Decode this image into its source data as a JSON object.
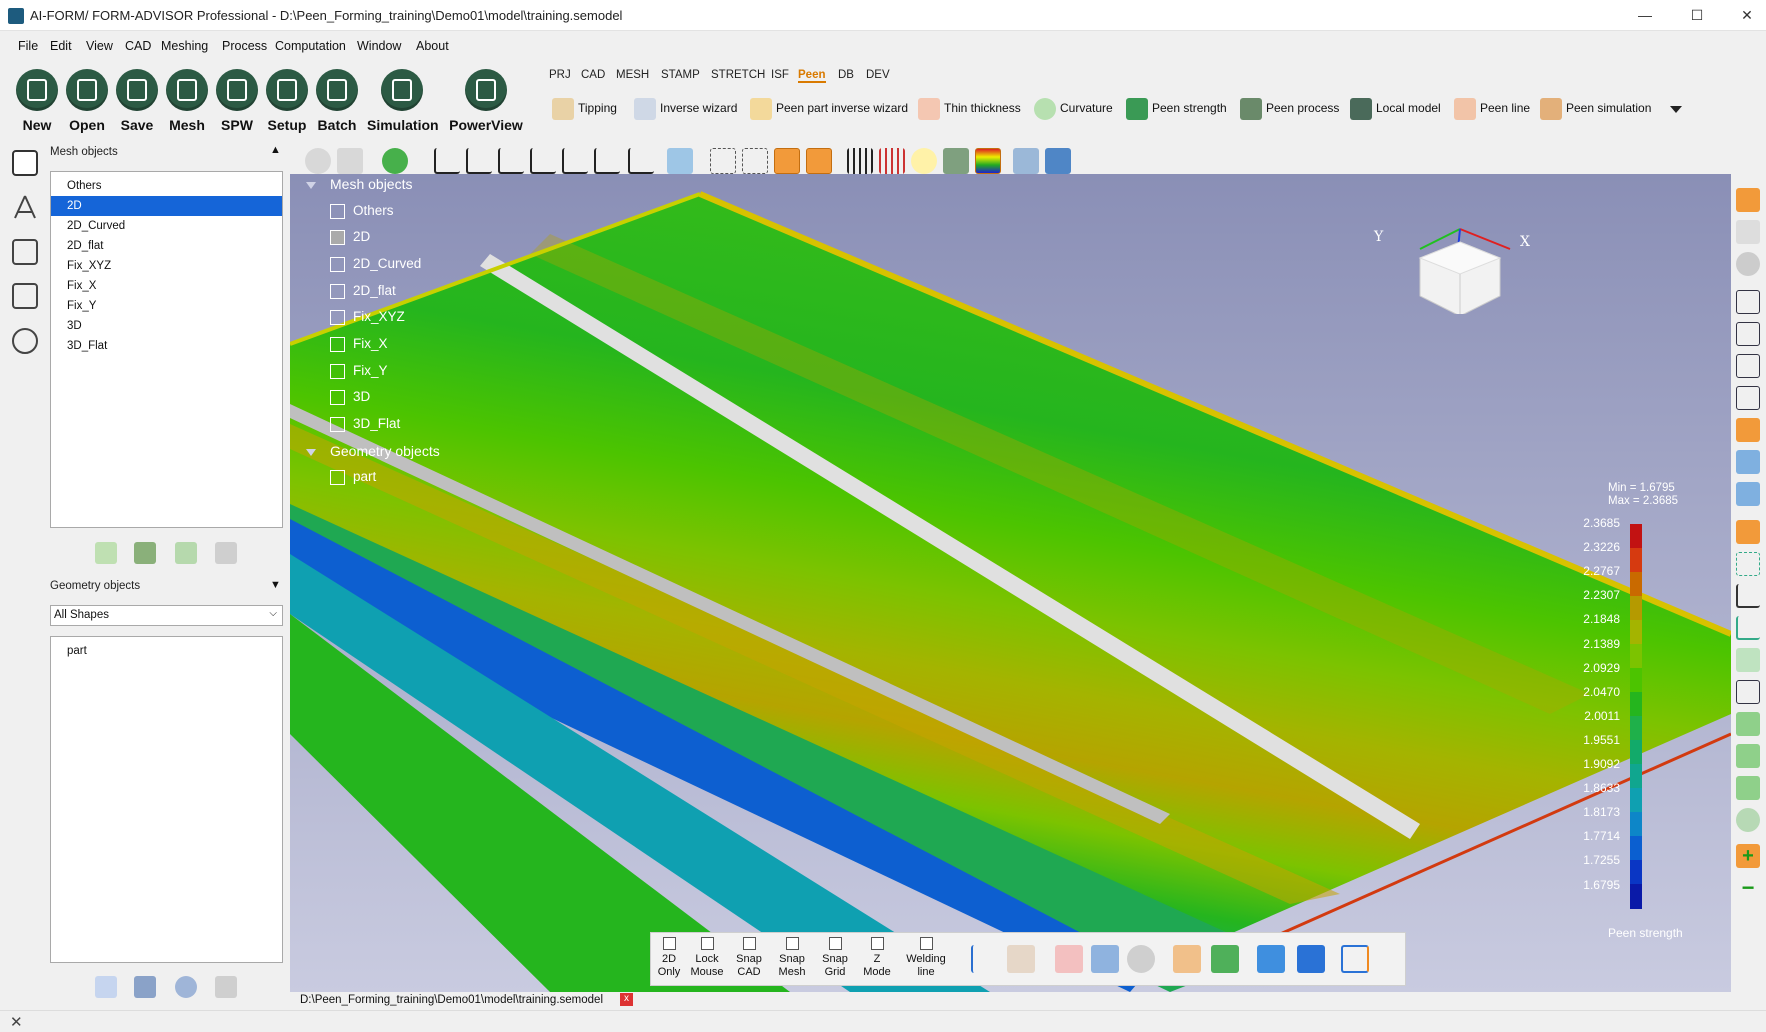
{
  "window": {
    "title": "AI-FORM/ FORM-ADVISOR Professional - D:\\Peen_Forming_training\\Demo01\\model\\training.semodel",
    "minimize": "—",
    "maximize": "☐",
    "close": "✕"
  },
  "menu": [
    "File",
    "Edit",
    "View",
    "CAD",
    "Meshing",
    "Process",
    "Computation",
    "Window",
    "About"
  ],
  "main_buttons": [
    "New",
    "Open",
    "Save",
    "Mesh",
    "SPW",
    "Setup",
    "Batch",
    "Simulation",
    "PowerView"
  ],
  "module_tabs": [
    "PRJ",
    "CAD",
    "MESH",
    "STAMP",
    "STRETCH",
    "ISF",
    "Peen",
    "DB",
    "DEV"
  ],
  "active_tab": "Peen",
  "peen_tools": [
    "Tipping",
    "Inverse wizard",
    "Peen part inverse wizard",
    "Thin thickness",
    "Curvature",
    "Peen strength",
    "Peen process",
    "Local model",
    "Peen line",
    "Peen simulation"
  ],
  "mesh_panel": {
    "title": "Mesh objects",
    "items": [
      "Others",
      "2D",
      "2D_Curved",
      "2D_flat",
      "Fix_XYZ",
      "Fix_X",
      "Fix_Y",
      "3D",
      "3D_Flat"
    ],
    "selected": "2D"
  },
  "geometry_panel": {
    "title": "Geometry objects",
    "filter": "All Shapes",
    "items": [
      "part"
    ]
  },
  "viewport_tree": {
    "mesh_header": "Mesh objects",
    "mesh_items": [
      "Others",
      "2D",
      "2D_Curved",
      "2D_flat",
      "Fix_XYZ",
      "Fix_X",
      "Fix_Y",
      "3D",
      "3D_Flat"
    ],
    "geometry_header": "Geometry objects",
    "geometry_items": [
      "part"
    ]
  },
  "axes": {
    "x": "X",
    "y": "Y"
  },
  "legend": {
    "min_label": "Min =  1.6795",
    "max_label": "Max =  2.3685",
    "values": [
      "2.3685",
      "2.3226",
      "2.2767",
      "2.2307",
      "2.1848",
      "2.1389",
      "2.0929",
      "2.0470",
      "2.0011",
      "1.9551",
      "1.9092",
      "1.8633",
      "1.8173",
      "1.7714",
      "1.7255",
      "1.6795"
    ],
    "title": "Peen strength",
    "colors": [
      "#c21212",
      "#d63a10",
      "#c96a00",
      "#b59a00",
      "#a4b400",
      "#7cc300",
      "#4cc400",
      "#25b51e",
      "#1fb04a",
      "#12aa6a",
      "#10a68f",
      "#0fa0b1",
      "#0d86c8",
      "#0b5fd0",
      "#0a36c4",
      "#0a1aa8"
    ]
  },
  "bottom_toggles": [
    {
      "l1": "2D",
      "l2": "Only"
    },
    {
      "l1": "Lock",
      "l2": "Mouse"
    },
    {
      "l1": "Snap",
      "l2": "CAD"
    },
    {
      "l1": "Snap",
      "l2": "Mesh"
    },
    {
      "l1": "Snap",
      "l2": "Grid"
    },
    {
      "l1": "Z",
      "l2": "Mode"
    },
    {
      "l1": "Welding",
      "l2": "line"
    }
  ],
  "file_tab": "D:\\Peen_Forming_training\\Demo01\\model\\training.semodel",
  "file_tab_close": "x"
}
